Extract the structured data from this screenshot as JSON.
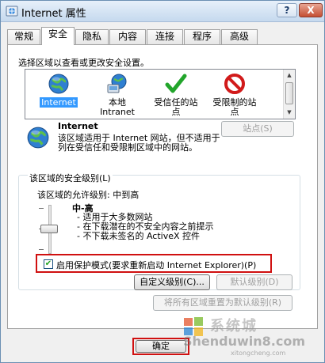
{
  "window": {
    "title": "Internet 属性",
    "help_glyph": "?",
    "close_glyph": "X"
  },
  "tabs": [
    {
      "label": "常规"
    },
    {
      "label": "安全",
      "active": true
    },
    {
      "label": "隐私"
    },
    {
      "label": "内容"
    },
    {
      "label": "连接"
    },
    {
      "label": "程序"
    },
    {
      "label": "高级"
    }
  ],
  "security": {
    "zone_prompt": "选择区域以查看或更改安全设置。",
    "zones": [
      {
        "label_line1": "Internet",
        "label_line2": "",
        "icon": "globe-icon",
        "selected": true
      },
      {
        "label_line1": "本地",
        "label_line2": "Intranet",
        "icon": "local-intranet-icon"
      },
      {
        "label_line1": "受信任的站",
        "label_line2": "点",
        "icon": "green-checkmark-icon"
      },
      {
        "label_line1": "受限制的站",
        "label_line2": "点",
        "icon": "red-no-entry-icon"
      }
    ],
    "zone_title": "Internet",
    "zone_desc": "该区域适用于 Internet 网站，但不适用于列在受信任和受限制区域中的网站。",
    "sites_button": "站点(S)",
    "group_label": "该区域的安全级别(L)",
    "allowed_levels": "该区域的允许级别: 中到高",
    "level_name": "中-高",
    "level_points": [
      "适用于大多数网站",
      "在下载潜在的不安全内容之前提示",
      "不下载未签名的 ActiveX 控件"
    ],
    "slider_level": "中-高",
    "protected_mode": {
      "checked": true,
      "label": "启用保护模式(要求重新启动 Internet Explorer)(P)"
    },
    "custom_level_button": "自定义级别(C)...",
    "default_level_button": "默认级别(D)",
    "reset_all_button": "将所有区域重置为默认级别(R)"
  },
  "footer": {
    "ok_button": "确定"
  },
  "watermark": {
    "cn": "系统城",
    "en": "Shenduwin8.com",
    "sub": "xitongcheng.com"
  },
  "colors": {
    "selection": "#3399ff",
    "highlight_box": "#d01010",
    "titlebar": "#c5d9ee"
  }
}
